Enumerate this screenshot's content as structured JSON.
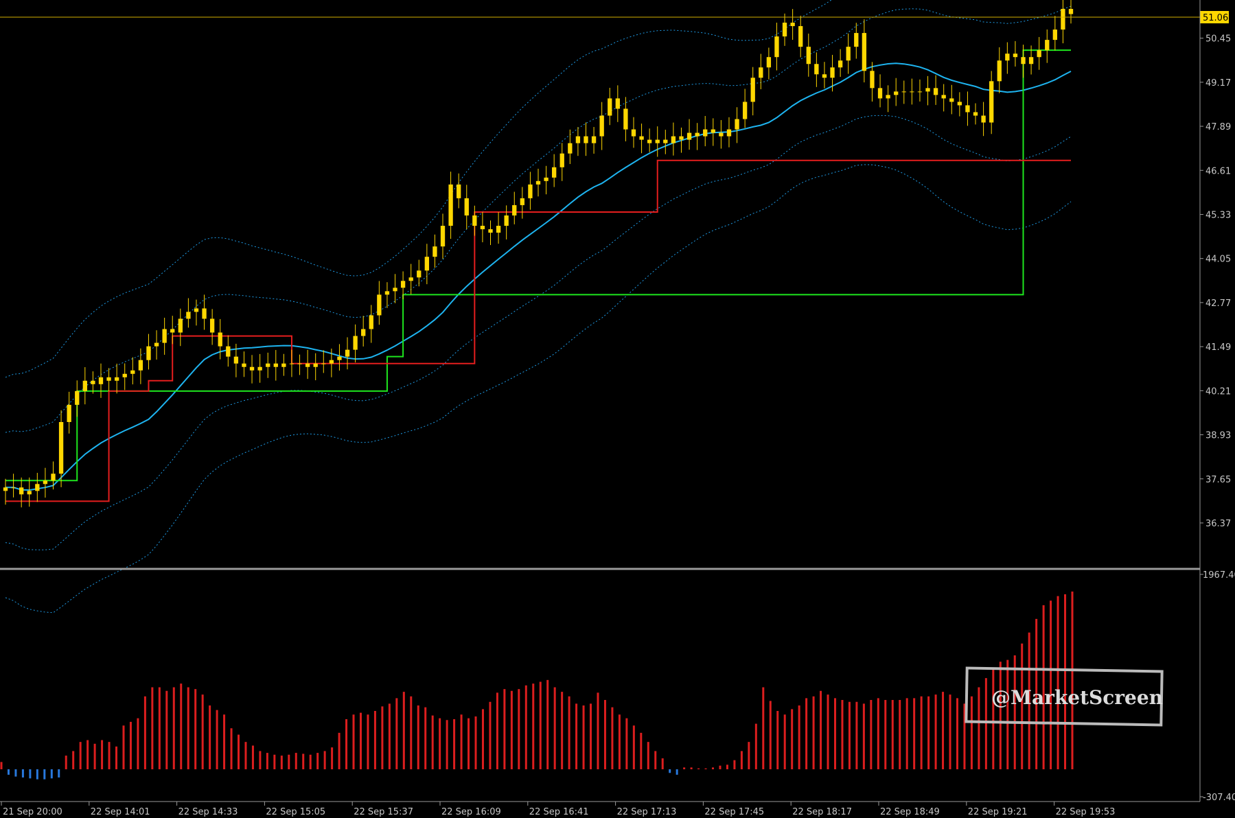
{
  "chart_data": [
    {
      "type": "candlestick",
      "panel": "price",
      "current_price": "51.06",
      "price_axis_ticks": [
        "50.45",
        "49.17",
        "47.89",
        "46.61",
        "45.33",
        "44.05",
        "42.77",
        "41.49",
        "40.21",
        "38.93",
        "37.65",
        "36.37"
      ],
      "price_axis_values": [
        50.45,
        49.17,
        47.89,
        46.61,
        45.33,
        44.05,
        42.77,
        41.49,
        40.21,
        38.93,
        37.65,
        36.37
      ],
      "ylim": [
        35.5,
        51.4
      ],
      "closes": [
        37.4,
        37.4,
        37.2,
        37.3,
        37.5,
        37.6,
        37.8,
        39.3,
        39.8,
        40.2,
        40.5,
        40.4,
        40.6,
        40.5,
        40.6,
        40.7,
        40.8,
        41.1,
        41.5,
        41.6,
        42.0,
        41.9,
        42.3,
        42.5,
        42.6,
        42.3,
        41.9,
        41.5,
        41.2,
        41.0,
        40.9,
        40.8,
        40.9,
        41.0,
        40.9,
        41.0,
        41.0,
        41.0,
        40.9,
        41.0,
        41.0,
        41.1,
        41.2,
        41.4,
        41.8,
        42.0,
        42.4,
        43.0,
        43.1,
        43.2,
        43.4,
        43.5,
        43.7,
        44.1,
        44.4,
        45.0,
        46.2,
        45.8,
        45.3,
        45.0,
        44.9,
        44.8,
        45.0,
        45.3,
        45.6,
        45.8,
        46.2,
        46.3,
        46.4,
        46.7,
        47.1,
        47.4,
        47.6,
        47.4,
        47.6,
        48.2,
        48.7,
        48.4,
        47.8,
        47.6,
        47.5,
        47.4,
        47.5,
        47.4,
        47.6,
        47.5,
        47.7,
        47.6,
        47.8,
        47.7,
        47.6,
        47.8,
        48.1,
        48.6,
        49.3,
        49.6,
        49.9,
        50.5,
        50.9,
        50.8,
        50.2,
        49.7,
        49.4,
        49.3,
        49.6,
        49.8,
        50.2,
        50.6,
        49.5,
        49.0,
        48.7,
        48.8,
        48.9,
        48.9,
        48.9,
        48.9,
        49.0,
        48.8,
        48.7,
        48.6,
        48.5,
        48.3,
        48.2,
        48.0,
        49.2,
        49.8,
        50.0,
        49.9,
        49.7,
        49.9,
        50.1,
        50.4,
        50.7,
        51.3,
        51.15
      ],
      "support_line_green": 50.1,
      "resistance_line_red": 46.9,
      "time_labels": [
        "21 Sep 20:00",
        "22 Sep 14:01",
        "22 Sep 14:33",
        "22 Sep 15:05",
        "22 Sep 15:37",
        "22 Sep 16:09",
        "22 Sep 16:41",
        "22 Sep 17:13",
        "22 Sep 17:45",
        "22 Sep 18:17",
        "22 Sep 18:49",
        "22 Sep 19:21",
        "22 Sep 19:53"
      ]
    },
    {
      "type": "bar",
      "panel": "oscillator",
      "axis_ticks": [
        "1967.40",
        "-307.40"
      ],
      "ylim": [
        -307.4,
        1967.4
      ],
      "values": [
        80,
        -60,
        -80,
        -90,
        -100,
        -110,
        -110,
        -100,
        -90,
        150,
        200,
        300,
        320,
        280,
        320,
        300,
        250,
        480,
        520,
        560,
        800,
        900,
        900,
        860,
        900,
        940,
        900,
        880,
        820,
        700,
        650,
        600,
        450,
        380,
        300,
        260,
        200,
        180,
        160,
        150,
        160,
        180,
        170,
        160,
        180,
        200,
        240,
        400,
        550,
        600,
        620,
        600,
        640,
        690,
        720,
        780,
        850,
        800,
        700,
        680,
        590,
        560,
        540,
        550,
        600,
        560,
        580,
        660,
        740,
        840,
        880,
        860,
        880,
        920,
        940,
        960,
        980,
        900,
        850,
        800,
        720,
        700,
        720,
        840,
        760,
        680,
        600,
        560,
        480,
        400,
        300,
        200,
        120,
        -40,
        -60,
        20,
        20,
        10,
        10,
        20,
        40,
        50,
        100,
        200,
        300,
        500,
        900,
        750,
        640,
        600,
        660,
        700,
        780,
        800,
        860,
        820,
        780,
        760,
        740,
        740,
        720,
        760,
        780,
        760,
        760,
        760,
        780,
        780,
        800,
        800,
        820,
        850,
        820,
        780,
        720,
        800,
        900,
        1000,
        1100,
        1180,
        1200,
        1250,
        1380,
        1500,
        1650,
        1800,
        1850,
        1900,
        1920,
        1950
      ]
    }
  ],
  "watermark": {
    "text": "@MarketScreen"
  },
  "colors": {
    "background": "#000000",
    "candle": "#ffd700",
    "price_line": "#ffd700",
    "ma_line": "#1eb4f0",
    "band_dotted": "#1e9be6",
    "green_step": "#1ee61e",
    "red_step": "#e61e1e",
    "hist_positive": "#dc1e1e",
    "hist_negative": "#2878dc",
    "axis_text": "#c8c8c8"
  }
}
